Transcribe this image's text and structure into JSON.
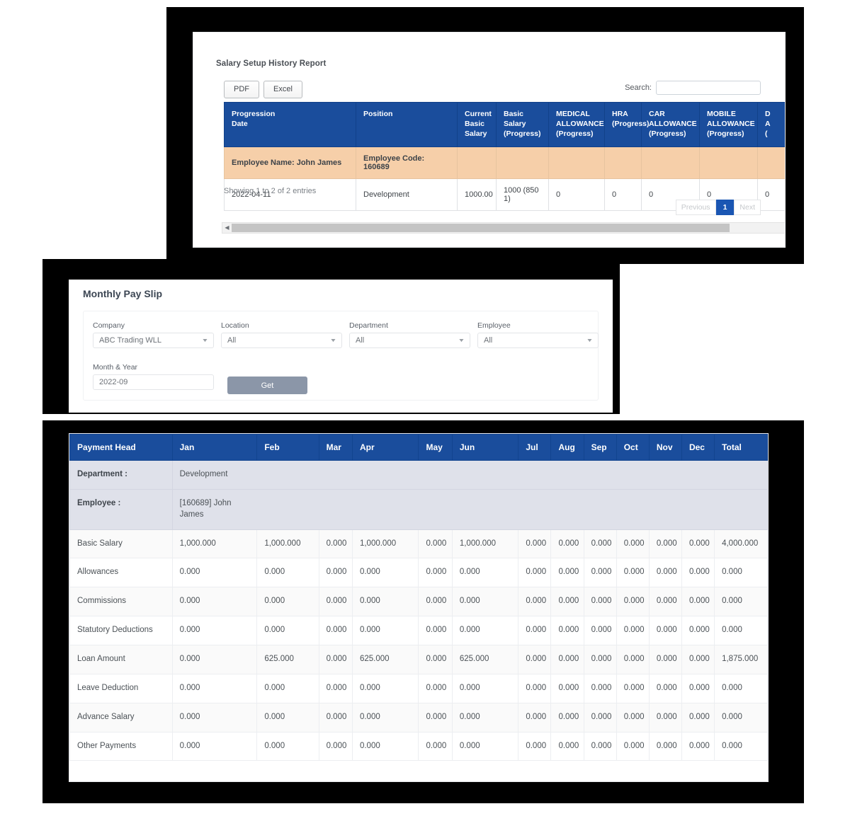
{
  "panel1": {
    "title": "Salary Setup History Report",
    "buttons": {
      "pdf": "PDF",
      "excel": "Excel"
    },
    "search": {
      "label": "Search:",
      "value": "",
      "placeholder": ""
    },
    "headers": [
      "Progression Date",
      "Position",
      "Current Basic Salary",
      "Basic Salary (Progress)",
      "MEDICAL ALLOWANCE (Progress)",
      "HRA (Progress)",
      "CAR ALLOWANCE (Progress)",
      "MOBILE ALLOWANCE (Progress)",
      "D ALLOWANCE (Progress)"
    ],
    "header_lines": [
      [
        "Progression",
        "Date"
      ],
      [
        "Position"
      ],
      [
        "Current",
        "Basic",
        "Salary"
      ],
      [
        "Basic Salary",
        "(Progress)"
      ],
      [
        "MEDICAL",
        "ALLOWANCE",
        "(Progress)"
      ],
      [
        "HRA",
        "(Progress)"
      ],
      [
        "CAR",
        "ALLOWANCE",
        "(Progress)"
      ],
      [
        "MOBILE",
        "ALLOWANCE",
        "(Progress)"
      ],
      [
        "D",
        "A",
        "("
      ]
    ],
    "employee_row": {
      "name": "Employee Name: John James",
      "code": "Employee Code: 160689"
    },
    "data_row": {
      "progression_date": "2022-04-11",
      "position": "Development",
      "current_basic_salary": "1000.00",
      "basic_salary_progress": "1000 (850 1)",
      "medical_allowance": "0",
      "hra": "0",
      "car_allowance": "0",
      "mobile_allowance": "0",
      "d_allowance": "0"
    },
    "footer_info": "Showing 1 to 2 of 2 entries",
    "pagination": {
      "previous": "Previous",
      "page": "1",
      "next": "Next"
    }
  },
  "panel2": {
    "title": "Monthly Pay Slip",
    "fields": {
      "company": {
        "label": "Company",
        "value": "ABC Trading WLL"
      },
      "location": {
        "label": "Location",
        "value": "All"
      },
      "department": {
        "label": "Department",
        "value": "All"
      },
      "employee": {
        "label": "Employee",
        "value": "All"
      },
      "month_year": {
        "label": "Month & Year",
        "value": "2022-09"
      }
    },
    "get_button": "Get"
  },
  "panel3": {
    "headers": [
      "Payment Head",
      "Jan",
      "Feb",
      "Mar",
      "Apr",
      "May",
      "Jun",
      "Jul",
      "Aug",
      "Sep",
      "Oct",
      "Nov",
      "Dec",
      "Total"
    ],
    "meta": [
      {
        "label": "Department :",
        "value": "Development"
      },
      {
        "label": "Employee :",
        "value": "[160689] John James"
      }
    ],
    "rows": [
      {
        "head": "Basic Salary",
        "values": [
          "1,000.000",
          "1,000.000",
          "0.000",
          "1,000.000",
          "0.000",
          "1,000.000",
          "0.000",
          "0.000",
          "0.000",
          "0.000",
          "0.000",
          "0.000"
        ],
        "total": "4,000.000"
      },
      {
        "head": "Allowances",
        "values": [
          "0.000",
          "0.000",
          "0.000",
          "0.000",
          "0.000",
          "0.000",
          "0.000",
          "0.000",
          "0.000",
          "0.000",
          "0.000",
          "0.000"
        ],
        "total": "0.000"
      },
      {
        "head": "Commissions",
        "values": [
          "0.000",
          "0.000",
          "0.000",
          "0.000",
          "0.000",
          "0.000",
          "0.000",
          "0.000",
          "0.000",
          "0.000",
          "0.000",
          "0.000"
        ],
        "total": "0.000"
      },
      {
        "head": "Statutory Deductions",
        "values": [
          "0.000",
          "0.000",
          "0.000",
          "0.000",
          "0.000",
          "0.000",
          "0.000",
          "0.000",
          "0.000",
          "0.000",
          "0.000",
          "0.000"
        ],
        "total": "0.000"
      },
      {
        "head": "Loan Amount",
        "values": [
          "0.000",
          "625.000",
          "0.000",
          "625.000",
          "0.000",
          "625.000",
          "0.000",
          "0.000",
          "0.000",
          "0.000",
          "0.000",
          "0.000"
        ],
        "total": "1,875.000"
      },
      {
        "head": "Leave Deduction",
        "values": [
          "0.000",
          "0.000",
          "0.000",
          "0.000",
          "0.000",
          "0.000",
          "0.000",
          "0.000",
          "0.000",
          "0.000",
          "0.000",
          "0.000"
        ],
        "total": "0.000"
      },
      {
        "head": "Advance Salary",
        "values": [
          "0.000",
          "0.000",
          "0.000",
          "0.000",
          "0.000",
          "0.000",
          "0.000",
          "0.000",
          "0.000",
          "0.000",
          "0.000",
          "0.000"
        ],
        "total": "0.000"
      },
      {
        "head": "Other Payments",
        "values": [
          "0.000",
          "0.000",
          "0.000",
          "0.000",
          "0.000",
          "0.000",
          "0.000",
          "0.000",
          "0.000",
          "0.000",
          "0.000",
          "0.000"
        ],
        "total": "0.000"
      }
    ]
  },
  "colors": {
    "table_header_blue": "#1a4d9c",
    "employee_row_orange": "#f6cfa9",
    "meta_row_lavender": "#dfe1ea",
    "get_button_gray_blue": "#8b96a8",
    "pagination_active_blue": "#1a56b3"
  }
}
